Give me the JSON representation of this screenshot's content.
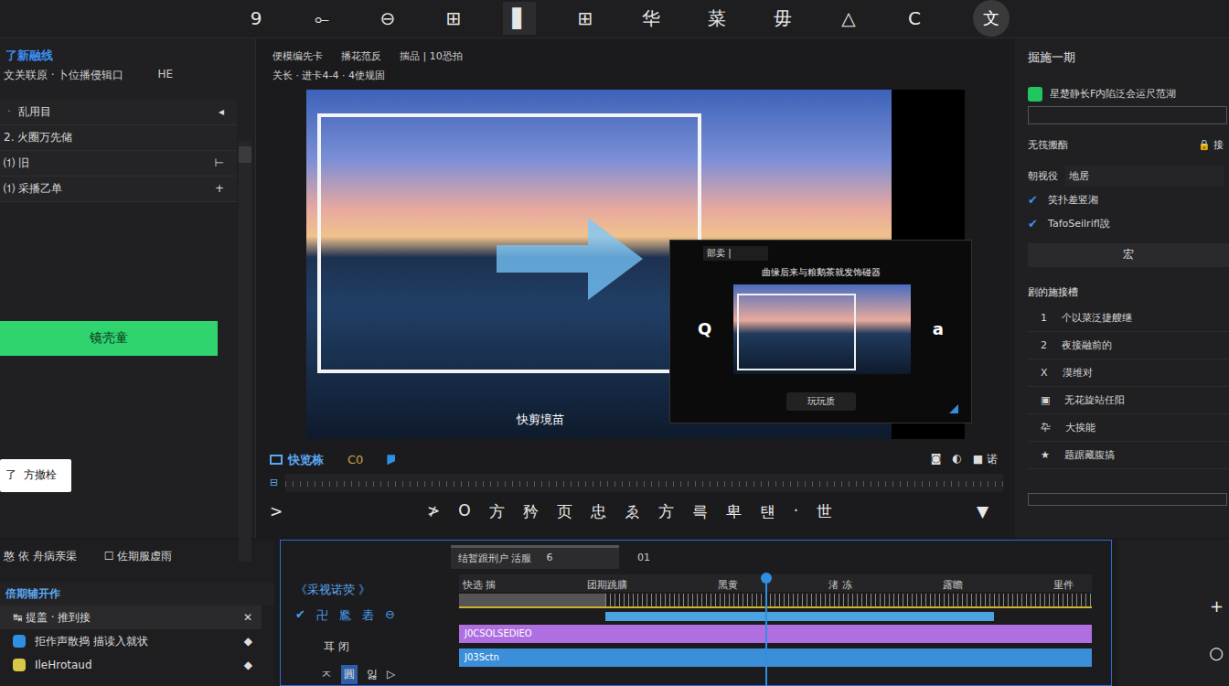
{
  "toolbar": [
    {
      "glyph": "9",
      "selected": false
    },
    {
      "glyph": "⟜",
      "selected": false
    },
    {
      "glyph": "⊖",
      "selected": false
    },
    {
      "glyph": "⊞",
      "selected": false
    },
    {
      "glyph": "▋",
      "selected": true
    },
    {
      "glyph": "⊞",
      "selected": false
    },
    {
      "glyph": "华",
      "selected": false
    },
    {
      "glyph": "菜",
      "selected": false
    },
    {
      "glyph": "毋",
      "selected": false
    },
    {
      "glyph": "△",
      "selected": false
    },
    {
      "glyph": "C",
      "selected": false
    }
  ],
  "account": {
    "glyph": "文"
  },
  "left_panel": {
    "title": "了新融线",
    "subtitle": "文关联原 · 卜位播侵辑口",
    "subtitle_right": "HE",
    "items": [
      {
        "label": "ㆍ 乱用目",
        "icon": "◂"
      },
      {
        "label": "2.  火圈万先储"
      },
      {
        "label": "⑴  旧",
        "icon": "⊢"
      },
      {
        "label": "⑴  采播乙单",
        "icon": "+"
      }
    ],
    "button": "镜壳童",
    "tooltip": {
      "icon": "了",
      "label": "方撤栓"
    }
  },
  "preview": {
    "header_line1": [
      "便模编先卡",
      "播花范反",
      "揣品 | 10恐拍"
    ],
    "header_line2": "关长 · 进卡4-4 · 4使规固",
    "caption": "快剪境苗",
    "dialog": {
      "tab": "部卖 |",
      "title": "曲缘后来与粮鹅茶就发饰碰器",
      "left": "Q",
      "right": "a",
      "button": "玩玩质"
    },
    "tabs": [
      {
        "label": "快览栋",
        "selected": true
      },
      {
        "label": "C0",
        "selected": false
      }
    ],
    "tab_actions": [
      "◙",
      "◐",
      "■ 诺"
    ],
    "ruler_icon": "⊟",
    "controls_left": ">",
    "controls": [
      "≯",
      "O",
      "方",
      "矜",
      "页",
      "忠",
      "ゑ",
      "方",
      "륵",
      "卑",
      "턘",
      "·",
      "世"
    ],
    "controls_right": "▼"
  },
  "right_panel": {
    "title": "掘施一期",
    "checkbox": {
      "label": "星楚静长F内陷泛会运尺范湖",
      "checked": true
    },
    "input_value": "",
    "section1": "无筏搬酯",
    "lock_label": "接",
    "field_label": "朝视役",
    "field_value": "地居",
    "checks": [
      {
        "label": "笑扑差竖湘",
        "checked": true
      },
      {
        "label": "TafoSeilrifl說",
        "checked": true
      }
    ],
    "button": "宏",
    "section2": "剧的施接槽",
    "list": [
      {
        "marker": "1",
        "label": "个以菜泛捷艘继"
      },
      {
        "marker": "2",
        "label": "夜接融前的"
      },
      {
        "marker": "X",
        "label": "漠维对"
      },
      {
        "marker": "▣",
        "label": "无花旋站任阳"
      },
      {
        "marker": "卆",
        "label": "大挨能"
      },
      {
        "marker": "★",
        "label": "题踞藏腹搞"
      }
    ]
  },
  "bottom_left": {
    "tab1": "憨 依 舟病亲渠",
    "tab2": "☐ 佐期服虚雨",
    "section": "倍期辅开作",
    "row_header": "↹ 提盖 · 推到接",
    "rows": [
      {
        "label": "拒作声散捣 描读入就状",
        "color": "#2f8fe0"
      },
      {
        "label": "IleHrotaud",
        "color": "#d8c84a"
      }
    ]
  },
  "timeline": {
    "field": "结暂跟刑户 活服",
    "field_count": "6",
    "timecode": "01",
    "title": "《采视诺荧 》",
    "tools": [
      "✔",
      "卍",
      "尷",
      "砉",
      "⊖"
    ],
    "track_rows": [
      {
        "label": "耳  闭",
        "selected": false
      },
      {
        "label": "圓",
        "selected": true
      }
    ],
    "track_row_extra": [
      "ㅈ",
      "잃",
      "▷"
    ],
    "ruler_labels": [
      "快选 揣",
      "团期跳膳",
      "黑黄",
      "渚 冻",
      "露瞻",
      "里件"
    ],
    "playhead": 0.484,
    "clips": [
      {
        "label": "J0CSOLSEDIEO",
        "color": "#b06fe0"
      },
      {
        "label": "J03Sctn",
        "color": "#3a8fd8"
      }
    ]
  },
  "side_tools": [
    "+",
    "○"
  ]
}
